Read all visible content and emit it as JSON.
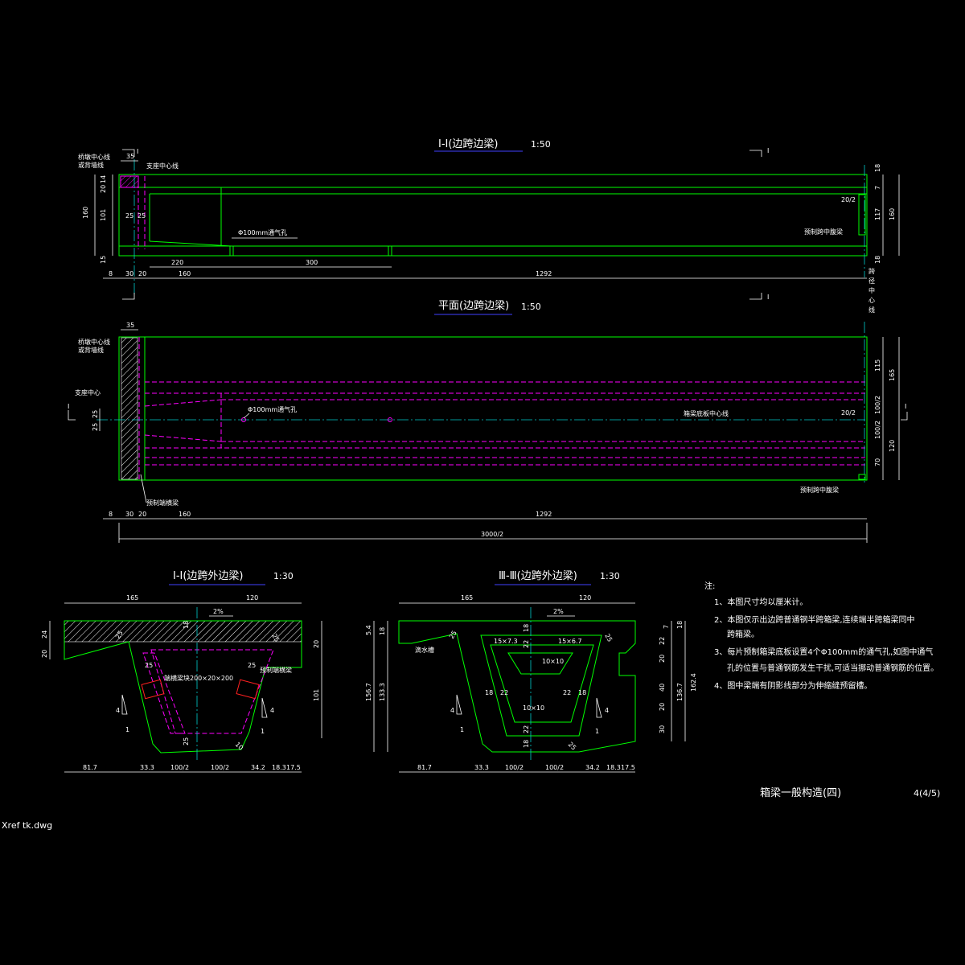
{
  "colors": {
    "background": "#000000",
    "outline": "#00ff00",
    "dimension": "#ffffff",
    "hidden_lines": "#ff00ff",
    "centerline": "#00cccc",
    "anchor_blocks": "#ff2020",
    "title_underline": "#4040ff"
  },
  "views": {
    "elevation": {
      "title": "Ⅰ-Ⅰ(边跨边梁)",
      "scale": "1:50",
      "label_left_1": "桥墩中心线",
      "label_left_2": "或背墙线",
      "label_support": "支座中心线",
      "label_vent": "Φ100mm通气孔",
      "label_precast": "预制跨中腹梁",
      "label_span_center": "跨径中心线",
      "section_mark": "Ⅰ",
      "dims": {
        "top_35": "35",
        "v_18_top": "18",
        "v_20": "20",
        "v_14": "14",
        "v_160": "160",
        "v_101": "101",
        "v_15": "15",
        "h_25a": "25",
        "h_25b": "25",
        "r_18_top": "18",
        "r_7": "7",
        "r_20_2": "20/2",
        "r_117": "117",
        "r_160": "160",
        "r_18_bot": "18",
        "seg_220": "220",
        "seg_300": "300",
        "b_8": "8",
        "b_30": "30",
        "b_20": "20",
        "b_160": "160",
        "b_1292": "1292"
      }
    },
    "plan": {
      "title": "平面(边跨边梁)",
      "scale": "1:50",
      "label_left_1": "桥墩中心线",
      "label_left_2": "或背墙线",
      "label_support": "支座中心",
      "label_vent": "Φ100mm通气孔",
      "label_axis": "箱梁底板中心线",
      "label_end": "预制端横梁",
      "label_precast": "预制跨中腹梁",
      "dims": {
        "top_35": "35",
        "l_25a": "25",
        "l_25b": "25",
        "r_115": "115",
        "r_165": "165",
        "r_100_2a": "100/2",
        "r_20_2": "20/2",
        "r_100_2b": "100/2",
        "r_120": "120",
        "r_70": "70",
        "b_8": "8",
        "b_30": "30",
        "b_20": "20",
        "b_160": "160",
        "b_1292": "1292",
        "b_total": "3000/2"
      }
    },
    "section_1": {
      "title": "Ⅰ-Ⅰ(边跨外边梁)",
      "scale": "1:30",
      "label_slope": "2%",
      "label_anchor": "端横梁块200×20×200",
      "label_end": "预制端横梁",
      "slope_num": "4",
      "slope_den": "1",
      "dims": {
        "top_165": "165",
        "top_120": "120",
        "l_24": "24",
        "l_20": "20",
        "r_20": "20",
        "r_101": "101",
        "in_25a": "25",
        "in_18": "18",
        "in_25b": "25",
        "in_25c": "25",
        "in_25d": "25",
        "in_25e": "25",
        "in_10": "10",
        "b_81_7": "81.7",
        "b_33_3": "33.3",
        "b_100_2a": "100/2",
        "b_100_2b": "100/2",
        "b_34_2": "34.2",
        "b_18_3": "18.3",
        "b_17_5": "17.5"
      }
    },
    "section_3": {
      "title": "Ⅲ-Ⅲ(边跨外边梁)",
      "scale": "1:30",
      "label_slope": "2%",
      "label_drip": "滴水槽",
      "slope_num": "4",
      "slope_den": "1",
      "dims": {
        "top_165": "165",
        "top_120": "120",
        "l_5_4": "5.4",
        "l_18": "18",
        "l_156_7": "156.7",
        "l_133_3": "133.3",
        "in_25a": "25",
        "in_18a": "18",
        "in_22a": "22",
        "in_15x7_3": "15×7.3",
        "in_15x6_7": "15×6.7",
        "in_10x10a": "10×10",
        "in_18b": "18",
        "in_22b": "22",
        "in_22c": "22",
        "in_18c": "18",
        "in_10x10b": "10×10",
        "in_22d": "22",
        "in_18d": "18",
        "in_25b": "25",
        "in_25c": "25",
        "r_7": "7",
        "r_18": "18",
        "r_22": "22",
        "r_20a": "20",
        "r_40": "40",
        "r_20b": "20",
        "r_30": "30",
        "r_136_7": "136.7",
        "r_162_4": "162.4",
        "b_81_7": "81.7",
        "b_33_3": "33.3",
        "b_100_2a": "100/2",
        "b_100_2b": "100/2",
        "b_34_2": "34.2",
        "b_18_3": "18.3",
        "b_17_5": "17.5"
      }
    }
  },
  "notes": {
    "heading": "注:",
    "items": [
      "1、本图尺寸均以厘米计。",
      "2、本图仅示出边跨普通钢半跨箱梁,连续端半跨箱梁同中",
      "跨箱梁。",
      "3、每片预制箱梁底板设置4个Φ100mm的通气孔,如图中通气",
      "孔的位置与普通钢筋发生干扰,可适当挪动普通钢筋的位置。",
      "4、图中梁端有阴影线部分为伸缩缝预留槽。"
    ]
  },
  "title_block": {
    "drawing_title": "箱梁一般构造(四)",
    "sheet": "4(4/5)",
    "xref": "Xref tk.dwg"
  }
}
